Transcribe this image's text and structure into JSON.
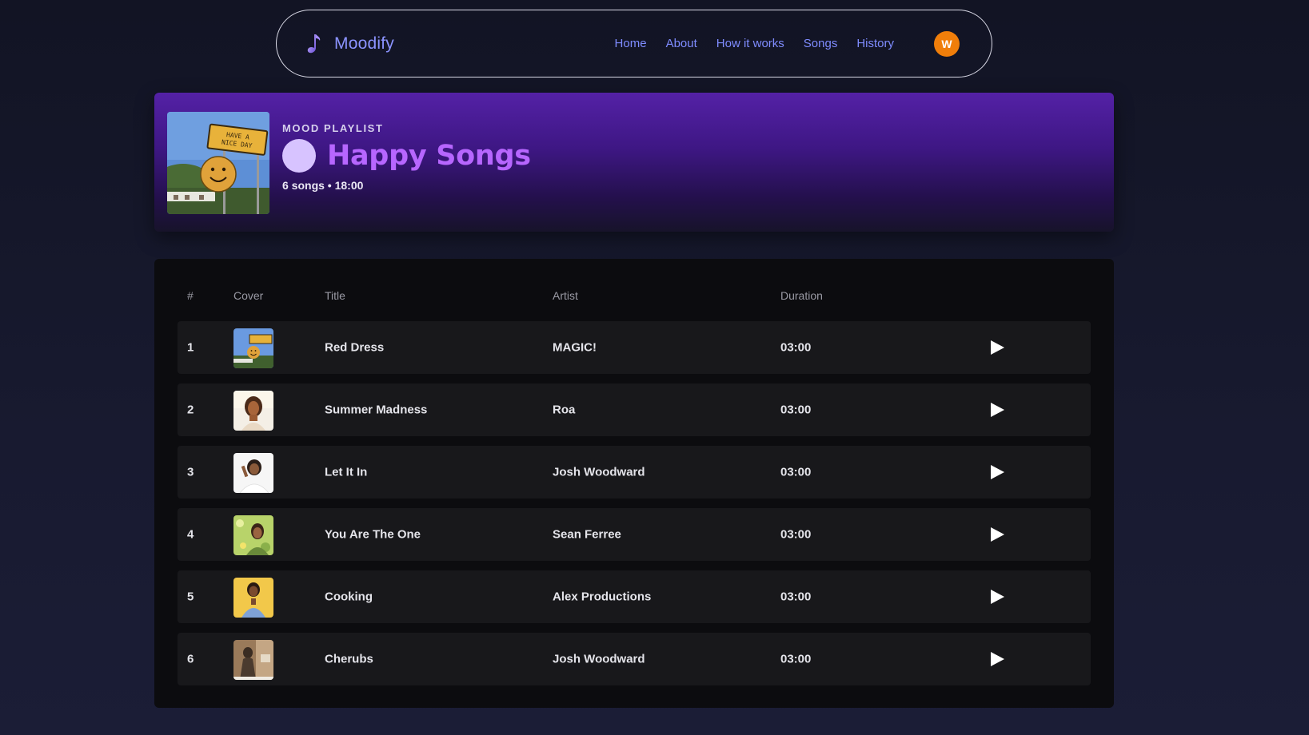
{
  "app": {
    "brand": "Moodify",
    "nav": [
      "Home",
      "About",
      "How it works",
      "Songs",
      "History"
    ],
    "avatar_initial": "W",
    "avatar_color": "#f07e0a",
    "accent": "#8b93ff"
  },
  "playlist": {
    "eyebrow": "MOOD PLAYLIST",
    "title": "Happy Songs",
    "meta": "6 songs • 18:00",
    "cover_sign_text": "HAVE A NICE DAY"
  },
  "table": {
    "headers": {
      "num": "#",
      "cover": "Cover",
      "title": "Title",
      "artist": "Artist",
      "duration": "Duration"
    },
    "rows": [
      {
        "num": "1",
        "title": "Red Dress",
        "artist": "MAGIC!",
        "duration": "03:00",
        "cover": "smiley-sign"
      },
      {
        "num": "2",
        "title": "Summer Madness",
        "artist": "Roa",
        "duration": "03:00",
        "cover": "woman-sunlight"
      },
      {
        "num": "3",
        "title": "Let It In",
        "artist": "Josh Woodward",
        "duration": "03:00",
        "cover": "woman-white-bg"
      },
      {
        "num": "4",
        "title": "You Are The One",
        "artist": "Sean Ferree",
        "duration": "03:00",
        "cover": "woman-flowers"
      },
      {
        "num": "5",
        "title": "Cooking",
        "artist": "Alex Productions",
        "duration": "03:00",
        "cover": "woman-yellow-bg"
      },
      {
        "num": "6",
        "title": "Cherubs",
        "artist": "Josh Woodward",
        "duration": "03:00",
        "cover": "statue-sepia"
      }
    ]
  }
}
